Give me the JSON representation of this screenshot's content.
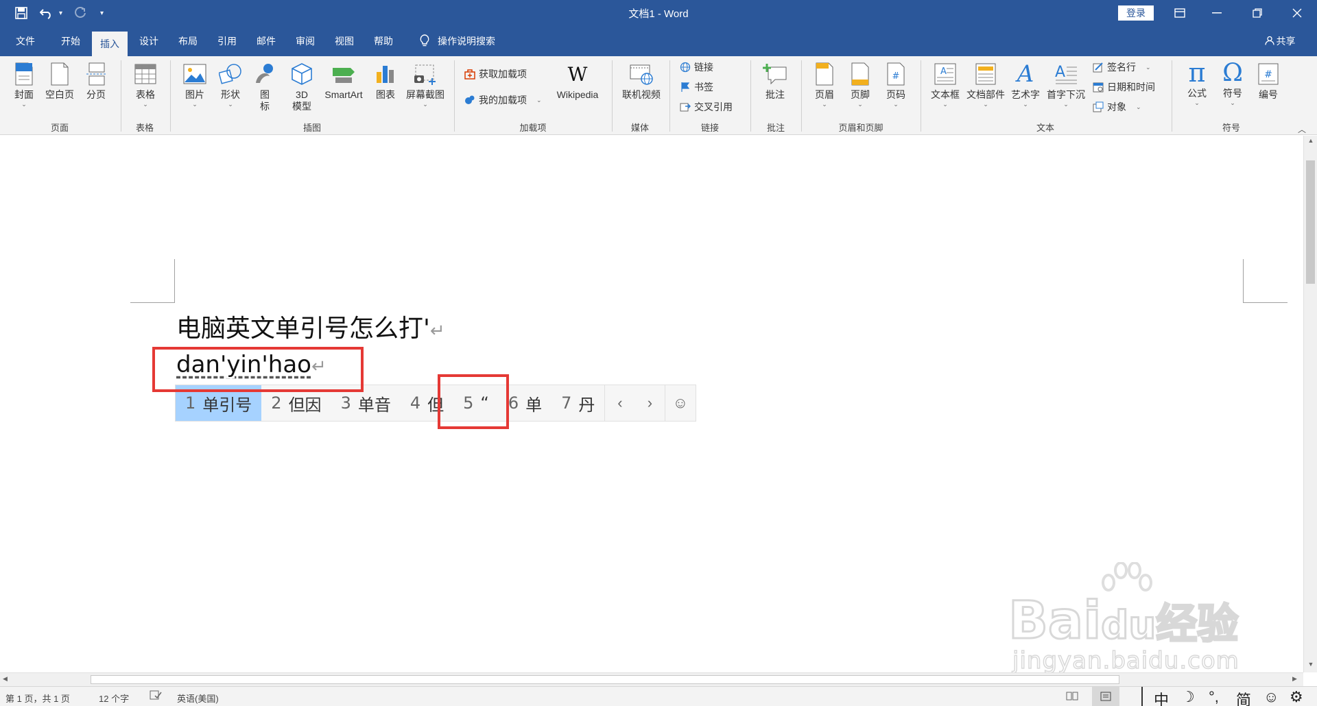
{
  "window": {
    "title": "文档1 - Word",
    "login_label": "登录",
    "share_label": "共享"
  },
  "quick_access": {
    "save_icon": "save-icon",
    "undo_icon": "undo-icon",
    "redo_icon": "redo-icon",
    "customize_icon": "customize-qat-icon"
  },
  "tabs": [
    {
      "label": "文件"
    },
    {
      "label": "开始"
    },
    {
      "label": "插入",
      "active": true
    },
    {
      "label": "设计"
    },
    {
      "label": "布局"
    },
    {
      "label": "引用"
    },
    {
      "label": "邮件"
    },
    {
      "label": "审阅"
    },
    {
      "label": "视图"
    },
    {
      "label": "帮助"
    }
  ],
  "tell_me": "操作说明搜索",
  "ribbon": {
    "groups": {
      "pages": "页面",
      "tables": "表格",
      "illustrations": "插图",
      "addins": "加载项",
      "media": "媒体",
      "links": "链接",
      "comments": "批注",
      "header_footer": "页眉和页脚",
      "text": "文本",
      "symbols": "符号"
    },
    "buttons": {
      "cover": "封面",
      "blank_page": "空白页",
      "page_break": "分页",
      "table": "表格",
      "pictures": "图片",
      "shapes": "形状",
      "icons": "图标",
      "model3d": "3D模型",
      "smartart": "SmartArt",
      "chart": "图表",
      "screenshot": "屏幕截图",
      "get_addins": "获取加载项",
      "my_addins": "我的加载项",
      "wikipedia": "Wikipedia",
      "online_video": "联机视频",
      "link": "链接",
      "bookmark": "书签",
      "cross_ref": "交叉引用",
      "comment": "批注",
      "header": "页眉",
      "footer": "页脚",
      "page_number": "页码",
      "text_box": "文本框",
      "quick_parts": "文档部件",
      "wordart": "艺术字",
      "drop_cap": "首字下沉",
      "signature_line": "签名行",
      "date_time": "日期和时间",
      "object": "对象",
      "equation": "公式",
      "symbol": "符号",
      "number": "编号"
    }
  },
  "document": {
    "line1": "电脑英文单引号怎么打'",
    "line2": "dan'yin'hao",
    "para_mark": "↵"
  },
  "ime": {
    "candidates": [
      {
        "num": "1",
        "text": "单引号",
        "selected": true
      },
      {
        "num": "2",
        "text": "但因"
      },
      {
        "num": "3",
        "text": "单音"
      },
      {
        "num": "4",
        "text": "但"
      },
      {
        "num": "5",
        "text": "“"
      },
      {
        "num": "6",
        "text": "单"
      },
      {
        "num": "7",
        "text": "丹"
      }
    ],
    "prev": "‹",
    "next": "›",
    "emoji": "☺"
  },
  "status": {
    "page": "第 1 页，共 1 页",
    "words": "12 个字",
    "language": "英语(美国)"
  },
  "taskbar_ime": {
    "mode": "中",
    "moon": "☽",
    "punct": "°,",
    "simp": "简",
    "emoji": "☺",
    "settings": "⚙"
  },
  "watermark": {
    "brand": "Bai",
    "brand2": "du",
    "cn": "经验",
    "url": "jingyan.baidu.com"
  },
  "colors": {
    "accent": "#2b579a",
    "highlight": "#e53935",
    "selection": "#a6d2ff"
  }
}
